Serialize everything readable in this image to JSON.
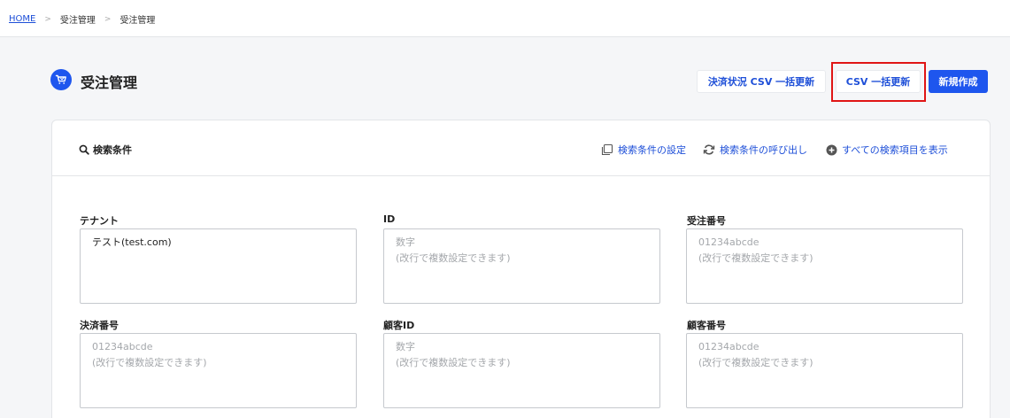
{
  "breadcrumb": {
    "home": "HOME",
    "sep": ">",
    "item1": "受注管理",
    "item2": "受注管理"
  },
  "header": {
    "title": "受注管理",
    "buttons": {
      "payment_csv": "決済状況 CSV 一括更新",
      "csv_bulk": "CSV 一括更新",
      "new": "新規作成"
    }
  },
  "search": {
    "title": "検索条件",
    "links": {
      "settings": "検索条件の設定",
      "recall": "検索条件の呼び出し",
      "show_all": "すべての検索項目を表示"
    }
  },
  "fields": {
    "tenant": {
      "label": "テナント",
      "value": "テスト(test.com)"
    },
    "id": {
      "label": "ID",
      "placeholder": "数字\n(改行で複数設定できます)"
    },
    "order_no": {
      "label": "受注番号",
      "placeholder": "01234abcde\n(改行で複数設定できます)"
    },
    "payment_no": {
      "label": "決済番号",
      "placeholder": "01234abcde\n(改行で複数設定できます)"
    },
    "customer_id": {
      "label": "顧客ID",
      "placeholder": "数字\n(改行で複数設定できます)"
    },
    "customer_no": {
      "label": "顧客番号",
      "placeholder": "01234abcde\n(改行で複数設定できます)"
    }
  },
  "colors": {
    "accent": "#1e56ee",
    "link": "#1e4fd8",
    "highlight": "#e01515"
  },
  "icons": [
    "cart-icon",
    "search-icon",
    "copy-icon",
    "refresh-icon",
    "plus-circle-icon"
  ]
}
